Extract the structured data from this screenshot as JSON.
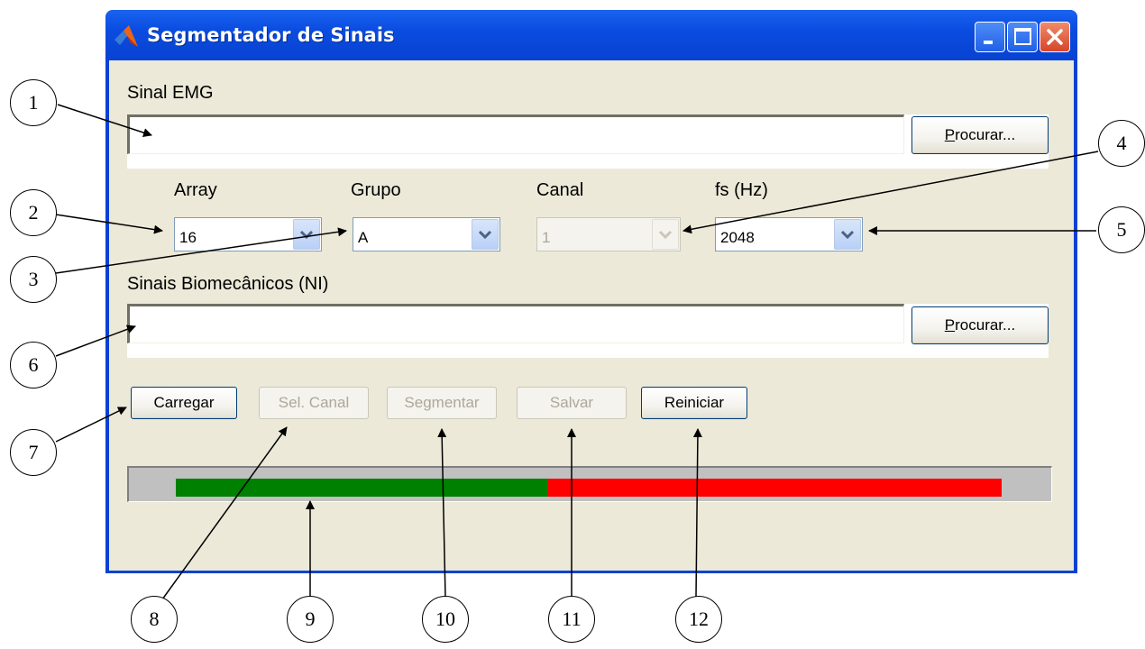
{
  "window": {
    "title": "Segmentador de Sinais"
  },
  "emg": {
    "label": "Sinal EMG",
    "value": "",
    "browse_label": "Procurar...",
    "browse_mnemonic": "P",
    "browse_rest": "rocurar..."
  },
  "selectors": {
    "array": {
      "label": "Array",
      "value": "16",
      "enabled": true
    },
    "grupo": {
      "label": "Grupo",
      "value": "A",
      "enabled": true
    },
    "canal": {
      "label": "Canal",
      "value": "1",
      "enabled": false
    },
    "fs": {
      "label": "fs (Hz)",
      "value": "2048",
      "enabled": true
    }
  },
  "biomech": {
    "label": "Sinais Biomecânicos (NI)",
    "value": "",
    "browse_label": "Procurar...",
    "browse_mnemonic": "P",
    "browse_rest": "rocurar..."
  },
  "actions": {
    "carregar": {
      "label": "Carregar",
      "enabled": true
    },
    "sel_canal": {
      "label": "Sel. Canal",
      "enabled": false
    },
    "segmentar": {
      "label": "Segmentar",
      "enabled": false
    },
    "salvar": {
      "label": "Salvar",
      "enabled": false
    },
    "reiniciar": {
      "label": "Reiniciar",
      "enabled": true
    }
  },
  "progress": {
    "fraction": 0.45,
    "done_color": "#008000",
    "remaining_color": "#ff0000"
  },
  "callouts": [
    "1",
    "2",
    "3",
    "4",
    "5",
    "6",
    "7",
    "8",
    "9",
    "10",
    "11",
    "12"
  ]
}
